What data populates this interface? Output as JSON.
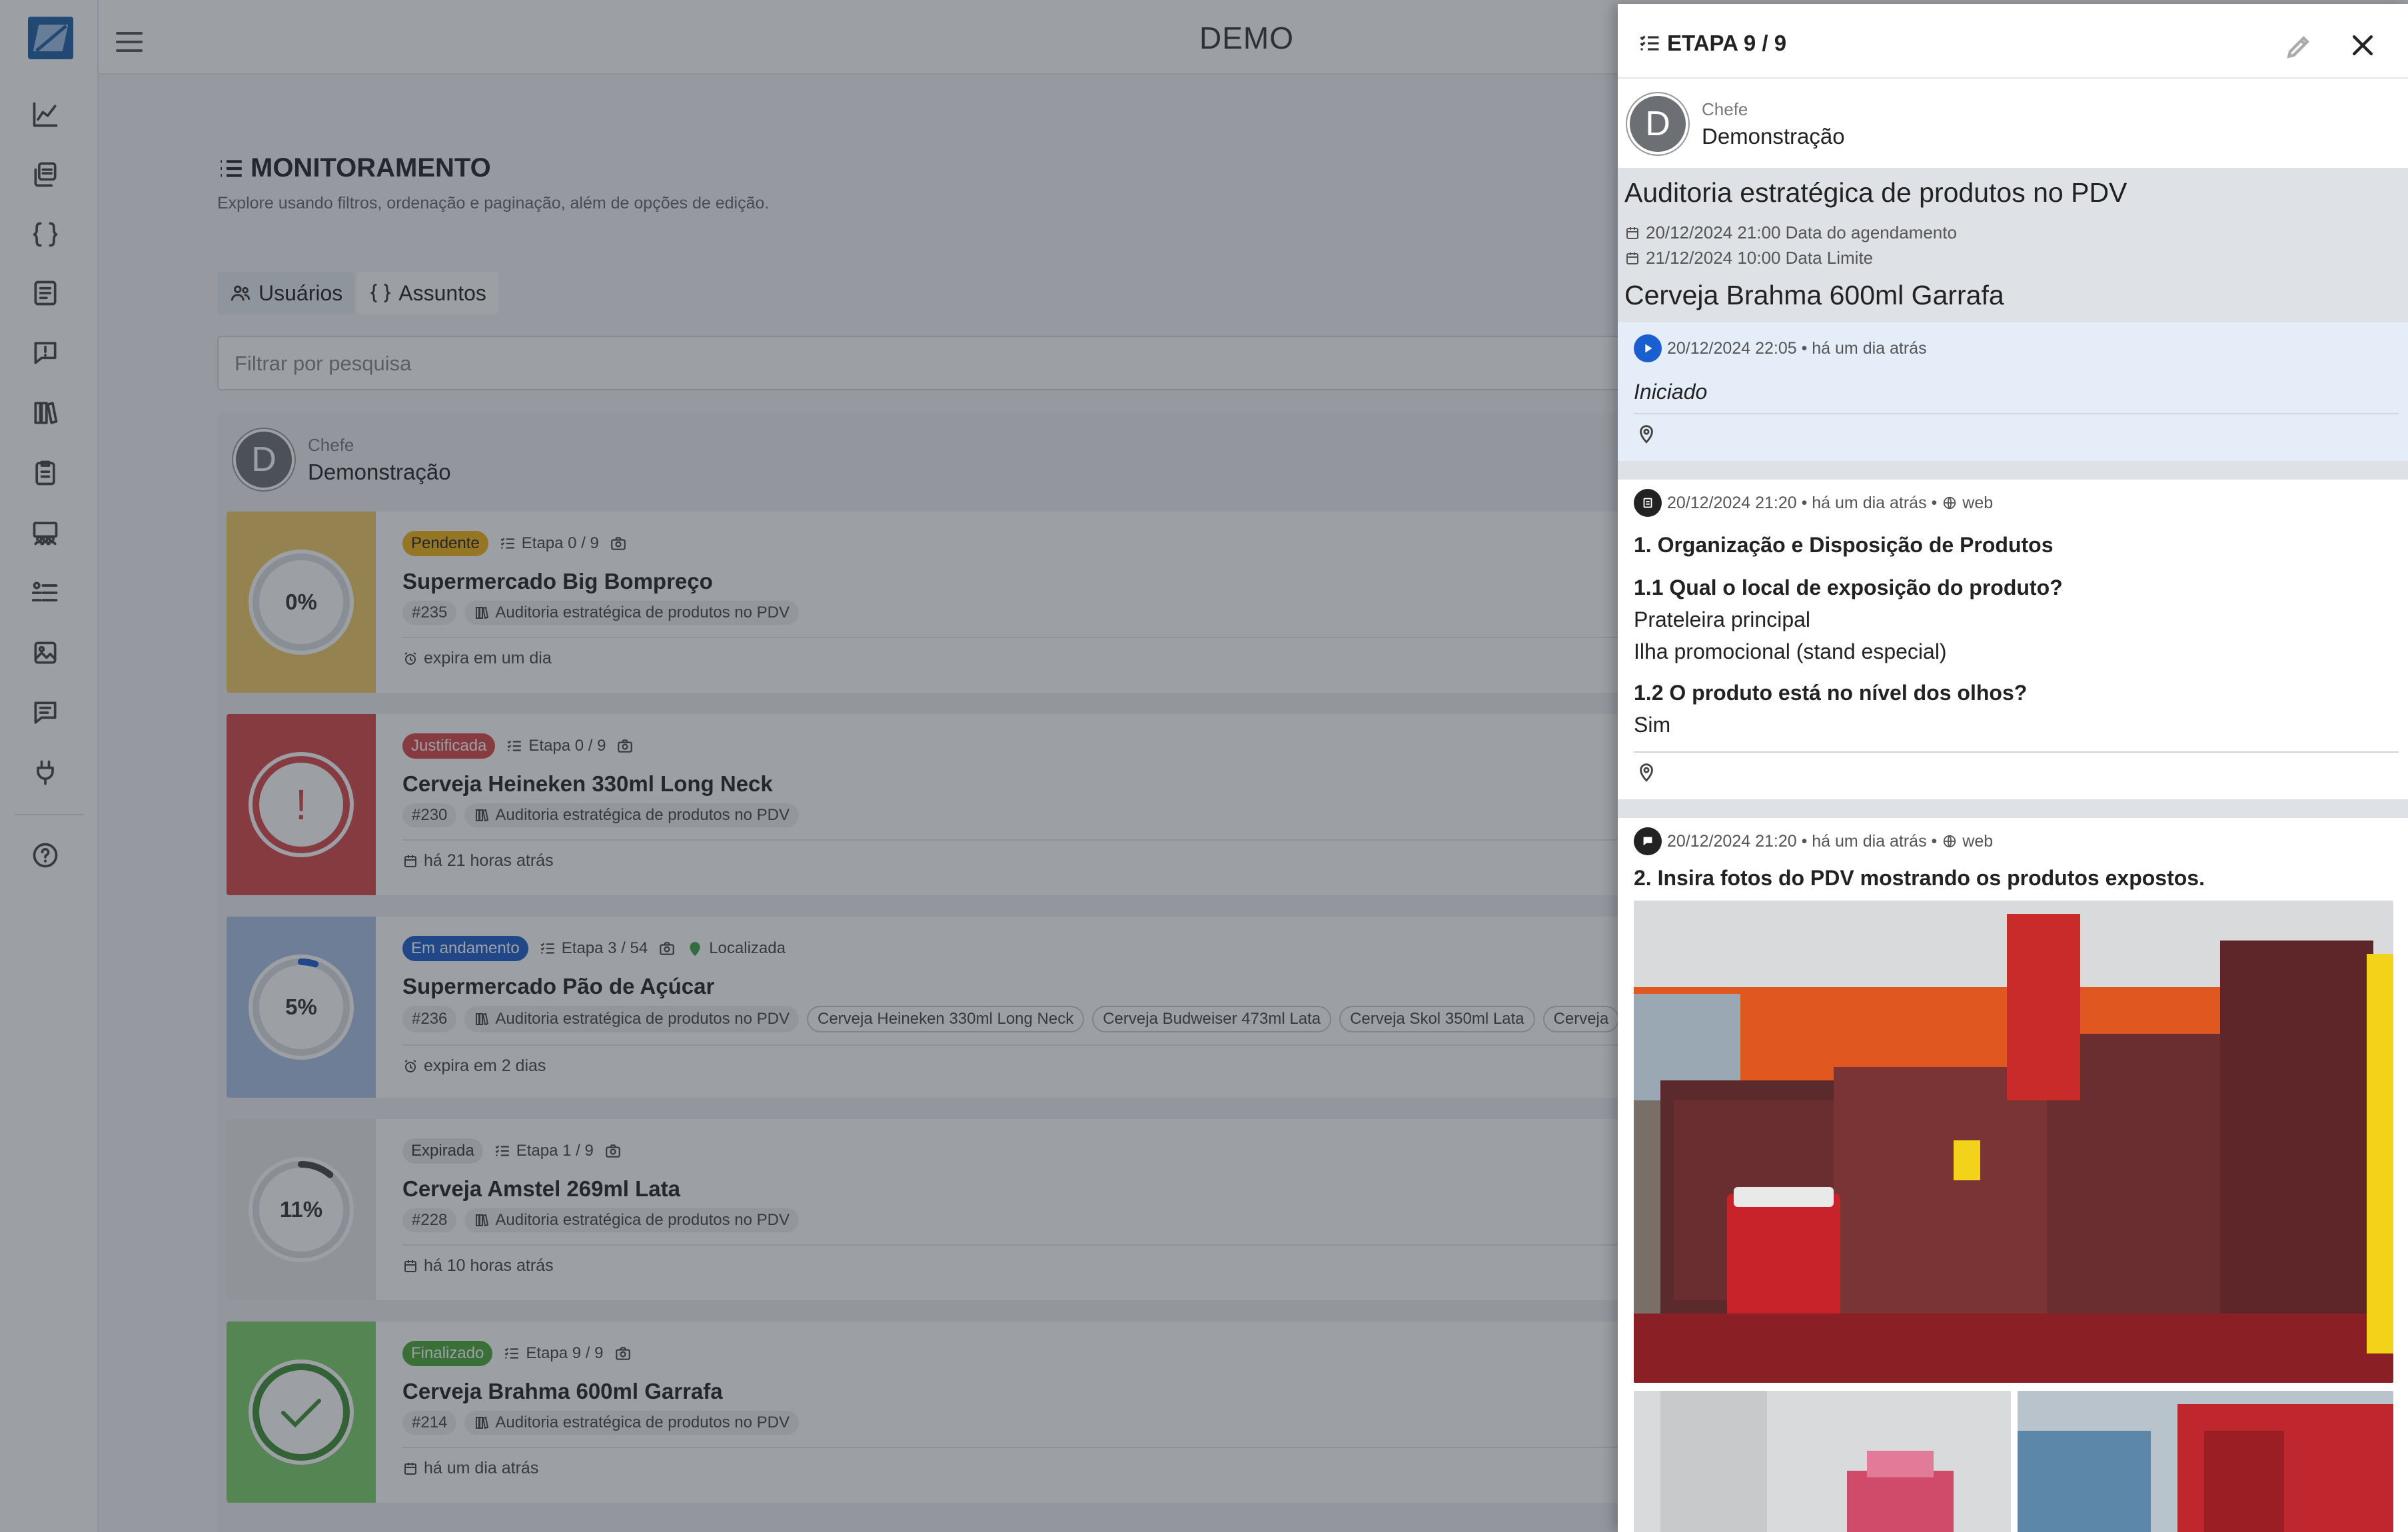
{
  "app": {
    "brand": "DEMO"
  },
  "sidebar": {
    "icons": [
      "chart-line-icon",
      "layers-icon",
      "braces-icon",
      "list-document-icon",
      "alert-message-icon",
      "books-icon",
      "clipboard-icon",
      "team-board-icon",
      "user-list-icon",
      "image-icon",
      "chat-icon",
      "plug-icon",
      "help-icon"
    ]
  },
  "page": {
    "title": "MONITORAMENTO",
    "subtitle": "Explore usando filtros, ordenação e paginação, além de opções de edição.",
    "tabs": [
      {
        "label": "Usuários"
      },
      {
        "label": "Assuntos"
      }
    ],
    "search_placeholder": "Filtrar por pesquisa"
  },
  "group": {
    "role": "Chefe",
    "name": "Demonstração",
    "avatar_letter": "D"
  },
  "cards": [
    {
      "progress_label": "0%",
      "progress": 0,
      "state": "progress",
      "color": "#f1cb68",
      "status": "Pendente",
      "status_color": "#f3b316",
      "status_text_color": "#222",
      "step": "Etapa 0 / 9",
      "location": "",
      "title": "Supermercado Big Bompreço",
      "id": "#235",
      "chips": [
        "Auditoria estratégica de produtos no PDV"
      ],
      "foot": "expira em um dia",
      "foot_icon": "alarm-icon"
    },
    {
      "progress_label": "!",
      "progress": 0,
      "state": "alert",
      "color": "#d7474a",
      "status": "Justificada",
      "status_color": "#d7474a",
      "status_text_color": "#fff",
      "step": "Etapa 0 / 9",
      "location": "",
      "title": "Cerveja Heineken 330ml Long Neck",
      "id": "#230",
      "chips": [
        "Auditoria estratégica de produtos no PDV"
      ],
      "foot": "há 21 horas atrás",
      "foot_icon": "calendar-icon"
    },
    {
      "progress_label": "5%",
      "progress": 0.05,
      "state": "progress",
      "color": "#a9c3e7",
      "status": "Em andamento",
      "status_color": "#1a5fd0",
      "status_text_color": "#fff",
      "step": "Etapa 3 / 54",
      "location": "Localizada",
      "title": "Supermercado Pão de Açúcar",
      "id": "#236",
      "chips": [
        "Auditoria estratégica de produtos no PDV",
        "Cerveja Heineken 330ml Long Neck",
        "Cerveja Budweiser 473ml Lata",
        "Cerveja Skol 350ml Lata",
        "Cerveja"
      ],
      "foot": "expira em 2 dias",
      "foot_icon": "alarm-icon"
    },
    {
      "progress_label": "11%",
      "progress": 0.11,
      "state": "progress",
      "color": "#e9eaec",
      "status": "Expirada",
      "status_color": "#e9eaec",
      "status_text_color": "#333",
      "step": "Etapa 1 / 9",
      "location": "",
      "title": "Cerveja Amstel 269ml Lata",
      "id": "#228",
      "chips": [
        "Auditoria estratégica de produtos no PDV"
      ],
      "foot": "há 10 horas atrás",
      "foot_icon": "calendar-icon"
    },
    {
      "progress_label": "",
      "progress": 1,
      "state": "done",
      "color": "#7dcf6a",
      "status": "Finalizado",
      "status_color": "#4aa63a",
      "status_text_color": "#fff",
      "step": "Etapa 9 / 9",
      "location": "",
      "title": "Cerveja Brahma 600ml Garrafa",
      "id": "#214",
      "chips": [
        "Auditoria estratégica de produtos no PDV"
      ],
      "foot": "há um dia atrás",
      "foot_icon": "calendar-icon"
    }
  ],
  "drawer": {
    "title": "ETAPA 9 / 9",
    "user": {
      "role": "Chefe",
      "name": "Demonstração",
      "avatar_letter": "D"
    },
    "task": {
      "title": "Auditoria estratégica de produtos no PDV",
      "scheduled": "20/12/2024 21:00 Data do agendamento",
      "deadline": "21/12/2024 10:00 Data Limite",
      "subject": "Cerveja Brahma 600ml Garrafa"
    },
    "event_started": {
      "time": "20/12/2024 22:05 • há um dia atrás",
      "status": "Iniciado"
    },
    "event_form": {
      "time": "20/12/2024 21:20 • há um dia atrás •",
      "source": "web",
      "section": "1. Organização e Disposição de Produtos",
      "q1": "1.1 Qual o local de exposição do produto?",
      "a1_1": "Prateleira principal",
      "a1_2": "Ilha promocional (stand especial)",
      "q2": "1.2 O produto está no nível dos olhos?",
      "a2": "Sim"
    },
    "event_photo": {
      "time": "20/12/2024 21:20 • há um dia atrás •",
      "source": "web",
      "question": "2. Insira fotos do PDV mostrando os produtos expostos."
    }
  }
}
